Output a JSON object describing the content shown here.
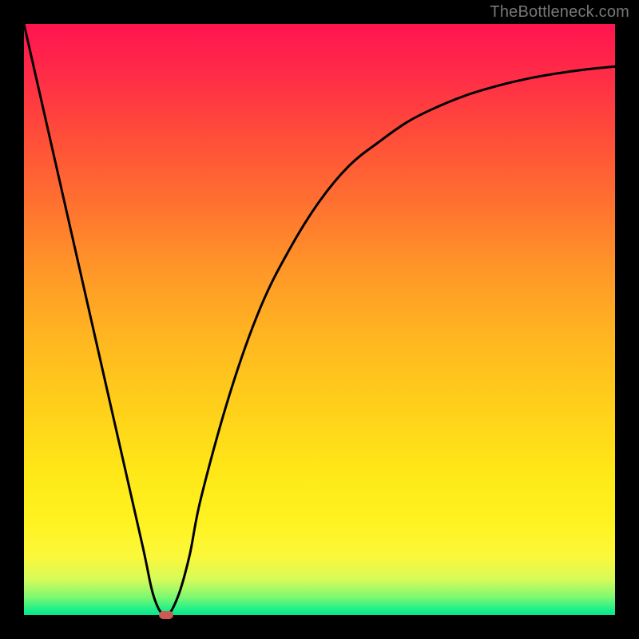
{
  "watermark": "TheBottleneck.com",
  "colors": {
    "frame": "#000000",
    "curve": "#000000",
    "marker": "#cc5a54",
    "gradient_top": "#ff1450",
    "gradient_bottom": "#08e48a"
  },
  "chart_data": {
    "type": "line",
    "title": "",
    "xlabel": "",
    "ylabel": "",
    "xlim": [
      0,
      100
    ],
    "ylim": [
      0,
      100
    ],
    "grid": false,
    "legend": false,
    "series": [
      {
        "name": "bottleneck-curve",
        "x": [
          0,
          5,
          10,
          15,
          20,
          22,
          24,
          26,
          28,
          30,
          35,
          40,
          45,
          50,
          55,
          60,
          65,
          70,
          75,
          80,
          85,
          90,
          95,
          100
        ],
        "y": [
          100,
          78,
          56,
          34,
          12,
          3,
          0,
          3,
          10,
          20,
          38,
          52,
          62,
          70,
          76,
          80,
          83.5,
          86,
          88,
          89.5,
          90.7,
          91.6,
          92.3,
          92.8
        ]
      }
    ],
    "annotations": [
      {
        "type": "marker",
        "x": 24,
        "y": 0,
        "shape": "pill",
        "color": "#cc5a54"
      }
    ]
  }
}
